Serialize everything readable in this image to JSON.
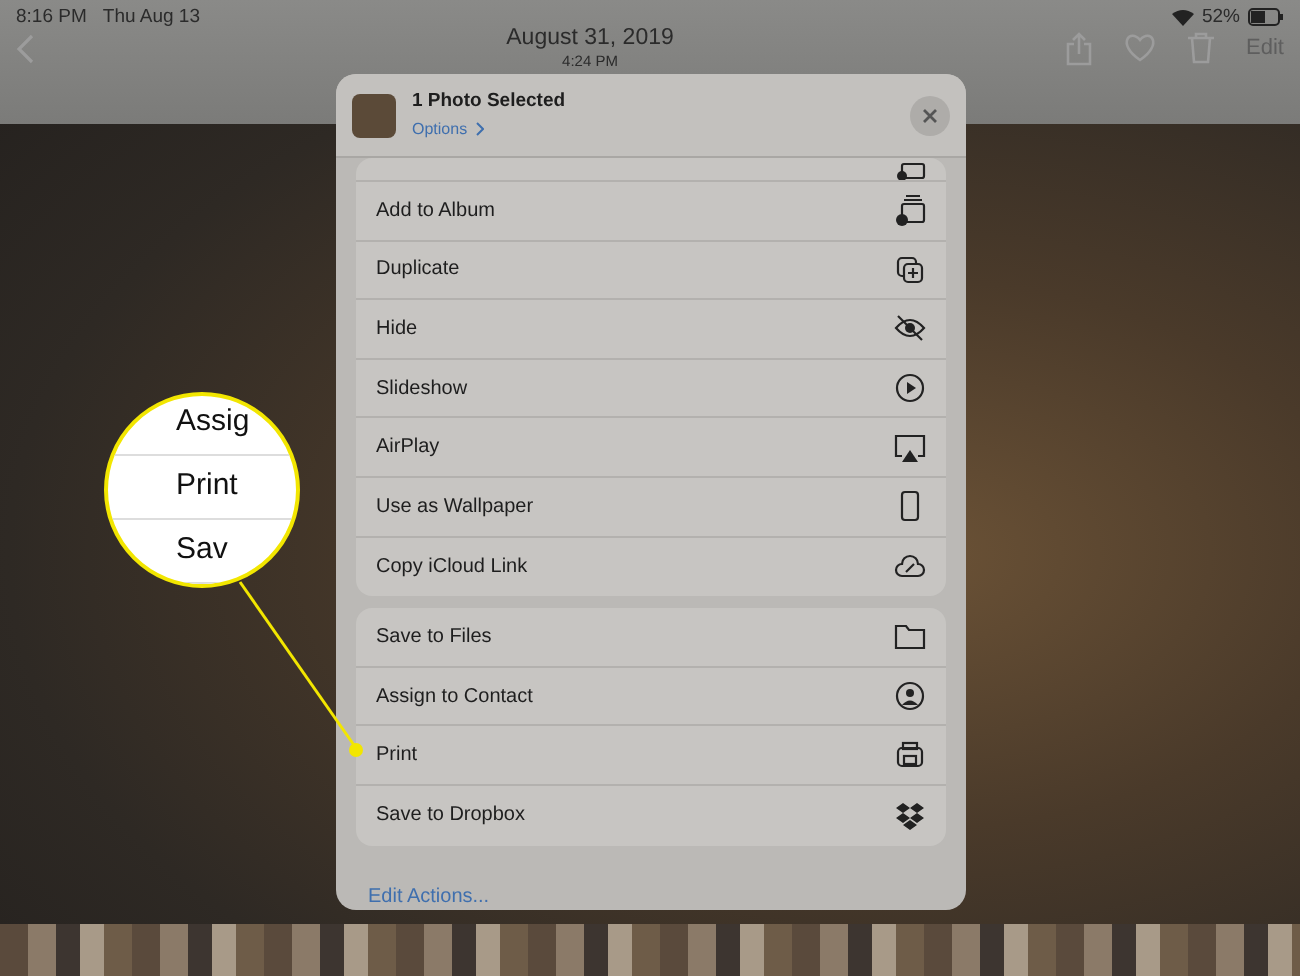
{
  "status_bar": {
    "time": "8:16 PM",
    "date": "Thu Aug 13",
    "battery": "52%"
  },
  "nav_bar": {
    "title": "August 31, 2019",
    "subtitle": "4:24 PM",
    "edit": "Edit"
  },
  "share_sheet": {
    "title": "1 Photo Selected",
    "options": "Options",
    "groups": [
      {
        "actions": [
          {
            "label": "Add to Album"
          },
          {
            "label": "Duplicate"
          },
          {
            "label": "Hide"
          },
          {
            "label": "Slideshow"
          },
          {
            "label": "AirPlay"
          },
          {
            "label": "Use as Wallpaper"
          },
          {
            "label": "Copy iCloud Link"
          }
        ]
      },
      {
        "actions": [
          {
            "label": "Save to Files"
          },
          {
            "label": "Assign to Contact"
          },
          {
            "label": "Print"
          },
          {
            "label": "Save to Dropbox"
          }
        ]
      }
    ],
    "edit_actions": "Edit Actions..."
  },
  "magnifier": {
    "lines": [
      "Assig",
      "Print",
      "Sav"
    ]
  }
}
